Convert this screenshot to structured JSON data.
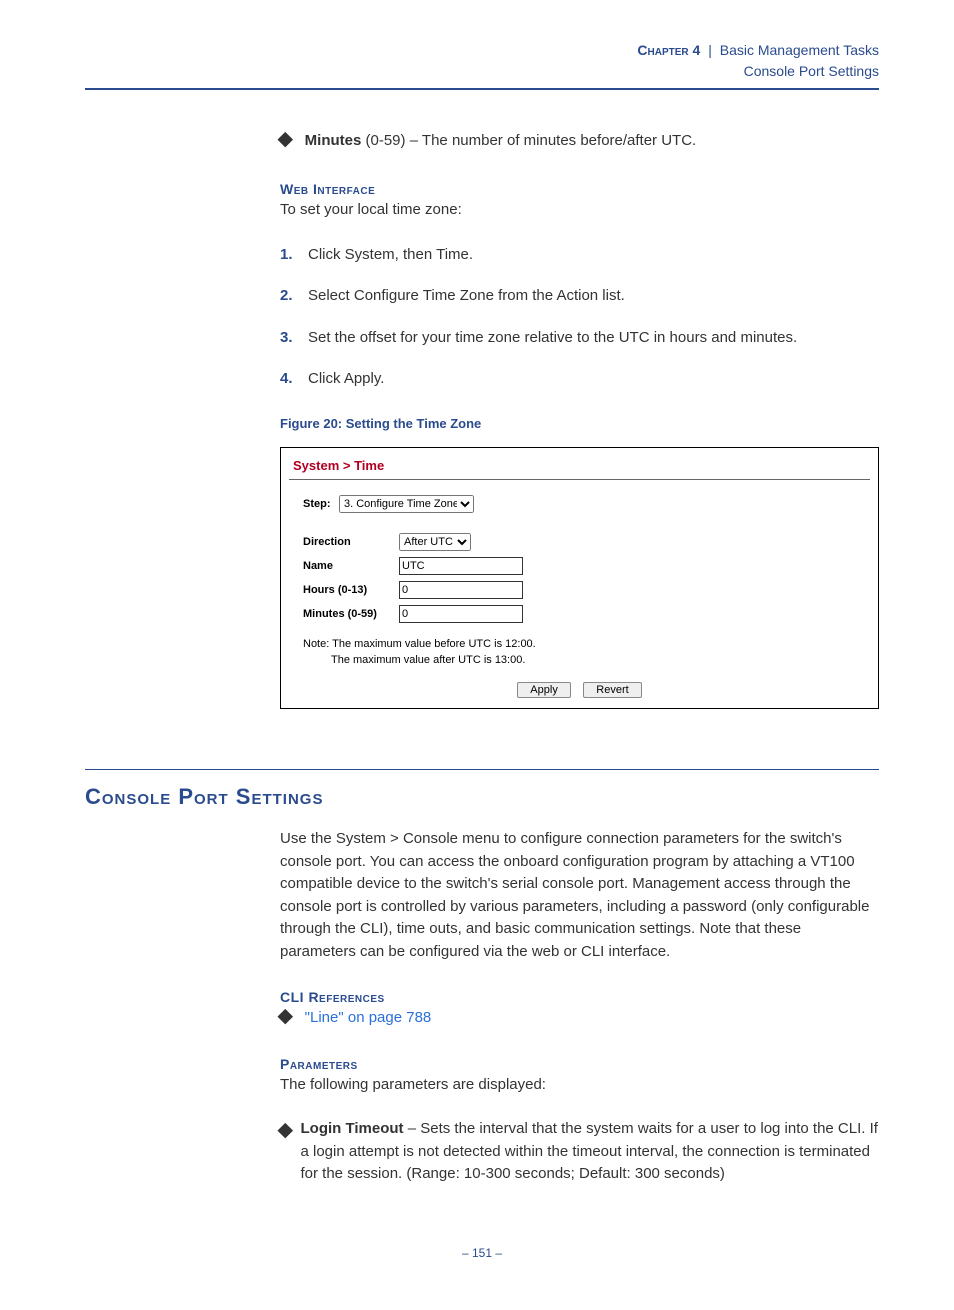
{
  "header": {
    "chapter_label": "Chapter 4",
    "separator": "|",
    "title": "Basic Management Tasks",
    "subtitle": "Console Port Settings"
  },
  "minutes_bullet": {
    "label": "Minutes",
    "desc": " (0-59) – The number of minutes before/after UTC."
  },
  "web_interface": {
    "heading": "Web Interface",
    "intro": "To set your local time zone:",
    "steps": [
      "Click System, then Time.",
      "Select Configure Time Zone from the Action list.",
      "Set the offset for your time zone relative to the UTC in hours and minutes.",
      "Click Apply."
    ]
  },
  "figure": {
    "caption": "Figure 20:  Setting the Time Zone",
    "breadcrumb": "System > Time",
    "step_label": "Step:",
    "step_value": "3. Configure Time Zone",
    "rows": {
      "direction": {
        "label": "Direction",
        "value": "After UTC"
      },
      "name": {
        "label": "Name",
        "value": "UTC"
      },
      "hours": {
        "label": "Hours (0-13)",
        "value": "0"
      },
      "minutes": {
        "label": "Minutes (0-59)",
        "value": "0"
      }
    },
    "note1": "Note: The maximum value before UTC is 12:00.",
    "note2": "The maximum value after UTC is 13:00.",
    "apply": "Apply",
    "revert": "Revert"
  },
  "console": {
    "title": "Console Port Settings",
    "body": "Use the System > Console menu to configure connection parameters for the switch's console port. You can access the onboard configuration program by attaching a VT100 compatible device to the switch's serial console port. Management access through the console port is controlled by various parameters, including a password (only configurable through the CLI), time outs, and basic communication settings. Note that these parameters can be configured via the web or CLI interface.",
    "cli_heading": "CLI References",
    "cli_link": "\"Line\" on page 788",
    "params_heading": "Parameters",
    "params_intro": "The following parameters are displayed:",
    "login_timeout": {
      "label": "Login Timeout",
      "desc": " – Sets the interval that the system waits for a user to log into the CLI. If a login attempt is not detected within the timeout interval, the connection is terminated for the session. (Range: 10-300 seconds; Default: 300 seconds)"
    }
  },
  "page_number": "–  151  –"
}
